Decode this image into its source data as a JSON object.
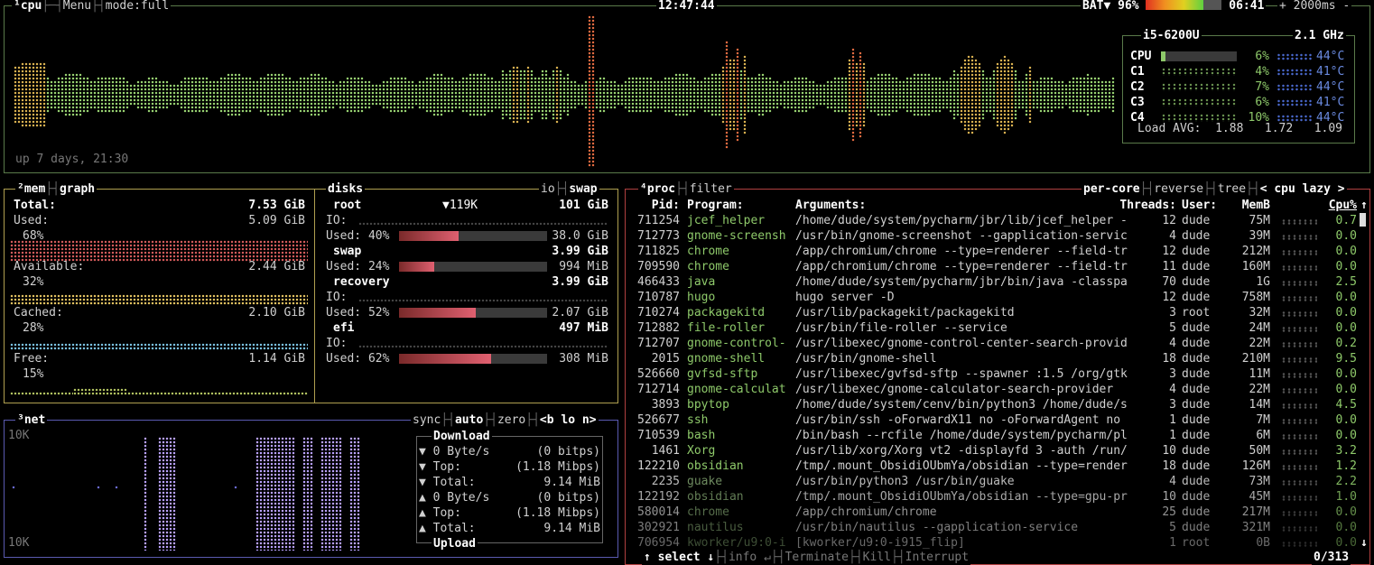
{
  "top": {
    "cpu_tag": "¹cpu",
    "menu": "Menu",
    "mode": "mode:full",
    "clock": "12:47:44",
    "battery": "BAT▼ 96%",
    "battery_time": "06:41",
    "interval": "+ 2000ms -",
    "uptime": "up 7 days, 21:30"
  },
  "cpu_info": {
    "model": "i5-6200U",
    "freq": "2.1 GHz",
    "rows": [
      {
        "name": "CPU",
        "pct": "6%",
        "temp": "44°C",
        "level": 0.06
      },
      {
        "name": "C1",
        "pct": "4%",
        "temp": "41°C",
        "level": 0.04
      },
      {
        "name": "C2",
        "pct": "7%",
        "temp": "44°C",
        "level": 0.07
      },
      {
        "name": "C3",
        "pct": "6%",
        "temp": "41°C",
        "level": 0.06
      },
      {
        "name": "C4",
        "pct": "10%",
        "temp": "44°C",
        "level": 0.1
      }
    ],
    "load_label": "Load AVG:",
    "load": [
      "1.88",
      "1.72",
      "1.09"
    ]
  },
  "mem": {
    "tag": "²mem",
    "graph": "graph",
    "total_label": "Total:",
    "total": "7.53 GiB",
    "used_label": "Used:",
    "used": "5.09 GiB",
    "used_pct": "68%",
    "avail_label": "Available:",
    "avail": "2.44 GiB",
    "avail_pct": "32%",
    "cached_label": "Cached:",
    "cached": "2.10 GiB",
    "cached_pct": "28%",
    "free_label": "Free:",
    "free": "1.14 GiB",
    "free_pct": "15%"
  },
  "disks": {
    "tag": "disks",
    "io": "io",
    "swap_tab": "swap",
    "io_label": "IO:",
    "used_label": "Used:",
    "root_speed": "▼119K",
    "items": [
      {
        "name": "root",
        "size": "101 GiB",
        "io": true,
        "pct": "40%",
        "used": "38.0 GiB",
        "level": 0.4
      },
      {
        "name": "swap",
        "size": "3.99 GiB",
        "io": false,
        "pct": "24%",
        "used": "994 MiB",
        "level": 0.24
      },
      {
        "name": "recovery",
        "size": "3.99 GiB",
        "io": true,
        "pct": "52%",
        "used": "2.07 GiB",
        "level": 0.52
      },
      {
        "name": "efi",
        "size": "497 MiB",
        "io": true,
        "pct": "62%",
        "used": "308 MiB",
        "level": 0.62
      }
    ]
  },
  "net": {
    "tag": "³net",
    "sync": "sync",
    "auto": "auto",
    "zero": "zero",
    "iface": "<b lo n>",
    "scale_top": "10K",
    "scale_bottom": "10K",
    "download": "Download",
    "upload": "Upload",
    "rows": [
      {
        "label": "▼ 0 Byte/s",
        "value": "(0 bitps)"
      },
      {
        "label": "▼ Top:",
        "value": "(1.18 Mibps)"
      },
      {
        "label": "▼ Total:",
        "value": "9.14 MiB"
      },
      {
        "label": "▲ 0 Byte/s",
        "value": "(0 bitps)"
      },
      {
        "label": "▲ Top:",
        "value": "(1.18 Mibps)"
      },
      {
        "label": "▲ Total:",
        "value": "9.14 MiB"
      }
    ]
  },
  "proc": {
    "tag": "⁴proc",
    "filter": "filter",
    "per_core": "per-core",
    "reverse": "reverse",
    "tree": "tree",
    "sort": "< cpu lazy >",
    "headers": {
      "pid": "Pid:",
      "program": "Program:",
      "args": "Arguments:",
      "threads": "Threads:",
      "user": "User:",
      "mem": "MemB",
      "cpu": "Cpu%"
    },
    "rows": [
      {
        "pid": "711254",
        "program": "jcef_helper",
        "args": "/home/dude/system/pycharm/jbr/lib/jcef_helper -",
        "threads": "12",
        "user": "dude",
        "mem": "75M",
        "cpu": "0.7"
      },
      {
        "pid": "712773",
        "program": "gnome-screensh",
        "args": "/usr/bin/gnome-screenshot --gapplication-servic",
        "threads": "4",
        "user": "dude",
        "mem": "39M",
        "cpu": "0.0"
      },
      {
        "pid": "711825",
        "program": "chrome",
        "args": "/app/chromium/chrome --type=renderer --field-tr",
        "threads": "12",
        "user": "dude",
        "mem": "212M",
        "cpu": "0.0"
      },
      {
        "pid": "709590",
        "program": "chrome",
        "args": "/app/chromium/chrome --type=renderer --field-tr",
        "threads": "11",
        "user": "dude",
        "mem": "160M",
        "cpu": "0.0"
      },
      {
        "pid": "466433",
        "program": "java",
        "args": "/home/dude/system/pycharm/jbr/bin/java -classpa",
        "threads": "70",
        "user": "dude",
        "mem": "1G",
        "cpu": "2.5"
      },
      {
        "pid": "710787",
        "program": "hugo",
        "args": "hugo server -D",
        "threads": "12",
        "user": "dude",
        "mem": "758M",
        "cpu": "0.0"
      },
      {
        "pid": "710274",
        "program": "packagekitd",
        "args": "/usr/lib/packagekit/packagekitd",
        "threads": "3",
        "user": "root",
        "mem": "32M",
        "cpu": "0.0"
      },
      {
        "pid": "712882",
        "program": "file-roller",
        "args": "/usr/bin/file-roller --service",
        "threads": "5",
        "user": "dude",
        "mem": "24M",
        "cpu": "0.0"
      },
      {
        "pid": "712707",
        "program": "gnome-control-",
        "args": "/usr/libexec/gnome-control-center-search-provid",
        "threads": "4",
        "user": "dude",
        "mem": "22M",
        "cpu": "0.2"
      },
      {
        "pid": "2015",
        "program": "gnome-shell",
        "args": "/usr/bin/gnome-shell",
        "threads": "18",
        "user": "dude",
        "mem": "210M",
        "cpu": "9.5"
      },
      {
        "pid": "526660",
        "program": "gvfsd-sftp",
        "args": "/usr/libexec/gvfsd-sftp --spawner :1.5 /org/gtk",
        "threads": "3",
        "user": "dude",
        "mem": "11M",
        "cpu": "0.0"
      },
      {
        "pid": "712714",
        "program": "gnome-calculat",
        "args": "/usr/libexec/gnome-calculator-search-provider",
        "threads": "4",
        "user": "dude",
        "mem": "22M",
        "cpu": "0.0"
      },
      {
        "pid": "3893",
        "program": "bpytop",
        "args": "/home/dude/system/cenv/bin/python3 /home/dude/s",
        "threads": "3",
        "user": "dude",
        "mem": "14M",
        "cpu": "4.5"
      },
      {
        "pid": "526677",
        "program": "ssh",
        "args": "/usr/bin/ssh -oForwardX11 no -oForwardAgent no",
        "threads": "1",
        "user": "dude",
        "mem": "7M",
        "cpu": "0.0"
      },
      {
        "pid": "710539",
        "program": "bash",
        "args": "/bin/bash --rcfile /home/dude/system/pycharm/pl",
        "threads": "1",
        "user": "dude",
        "mem": "6M",
        "cpu": "0.0"
      },
      {
        "pid": "1461",
        "program": "Xorg",
        "args": "/usr/lib/xorg/Xorg vt2 -displayfd 3 -auth /run/",
        "threads": "10",
        "user": "dude",
        "mem": "50M",
        "cpu": "3.2"
      },
      {
        "pid": "122210",
        "program": "obsidian",
        "args": "/tmp/.mount_ObsidiOUbmYa/obsidian --type=render",
        "threads": "18",
        "user": "dude",
        "mem": "126M",
        "cpu": "1.2"
      },
      {
        "pid": "2235",
        "program": "guake",
        "args": "/usr/bin/python3 /usr/bin/guake",
        "threads": "4",
        "user": "dude",
        "mem": "73M",
        "cpu": "2.2"
      },
      {
        "pid": "122192",
        "program": "obsidian",
        "args": "/tmp/.mount_ObsidiOUbmYa/obsidian --type=gpu-pr",
        "threads": "10",
        "user": "dude",
        "mem": "45M",
        "cpu": "1.0"
      },
      {
        "pid": "580014",
        "program": "chrome",
        "args": "/app/chromium/chrome",
        "threads": "25",
        "user": "dude",
        "mem": "217M",
        "cpu": "0.0"
      },
      {
        "pid": "302921",
        "program": "nautilus",
        "args": "/usr/bin/nautilus --gapplication-service",
        "threads": "5",
        "user": "dude",
        "mem": "321M",
        "cpu": "0.0"
      },
      {
        "pid": "706954",
        "program": "kworker/u9:0-i",
        "args": "[kworker/u9:0-i915_flip]",
        "threads": "1",
        "user": "root",
        "mem": "0B",
        "cpu": "0.0"
      }
    ],
    "footer": {
      "select": "↑ select ↓",
      "info": "info ↵",
      "terminate": "Terminate",
      "kill": "Kill",
      "interrupt": "Interrupt",
      "count": "0/313"
    },
    "scroll_up": "↑",
    "scroll_down": "↓"
  }
}
